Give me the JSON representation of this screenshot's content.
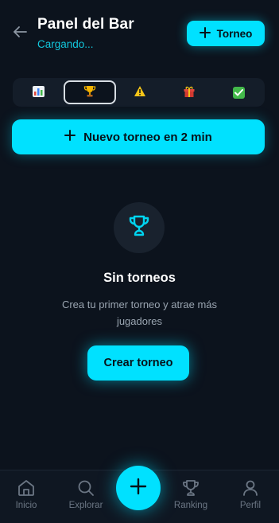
{
  "header": {
    "title": "Panel del Bar",
    "subtitle": "Cargando...",
    "torneo_button_label": "Torneo"
  },
  "tabs": [
    {
      "icon": "bar-chart-icon",
      "glyph": "📊",
      "active": false
    },
    {
      "icon": "trophy-icon",
      "glyph": "🏆",
      "active": true
    },
    {
      "icon": "warning-icon",
      "glyph": "⚠",
      "active": false
    },
    {
      "icon": "gift-icon",
      "glyph": "🎁",
      "active": false
    },
    {
      "icon": "check-icon",
      "glyph": "✓",
      "active": false
    }
  ],
  "main": {
    "new_tournament_label": "Nuevo torneo en 2 min",
    "empty_title": "Sin torneos",
    "empty_description": "Crea tu primer torneo y atrae más jugadores",
    "create_button_label": "Crear torneo"
  },
  "bottom_nav": {
    "items": [
      {
        "label": "Inicio",
        "icon": "home-icon"
      },
      {
        "label": "Explorar",
        "icon": "search-icon"
      },
      {
        "label": "Ranking",
        "icon": "trophy-icon"
      },
      {
        "label": "Perfil",
        "icon": "user-icon"
      }
    ],
    "fab_icon": "plus-icon"
  },
  "colors": {
    "background": "#0c131d",
    "accent": "#00e1ff",
    "subtitle": "#12c7dc",
    "muted": "#6b7684"
  }
}
